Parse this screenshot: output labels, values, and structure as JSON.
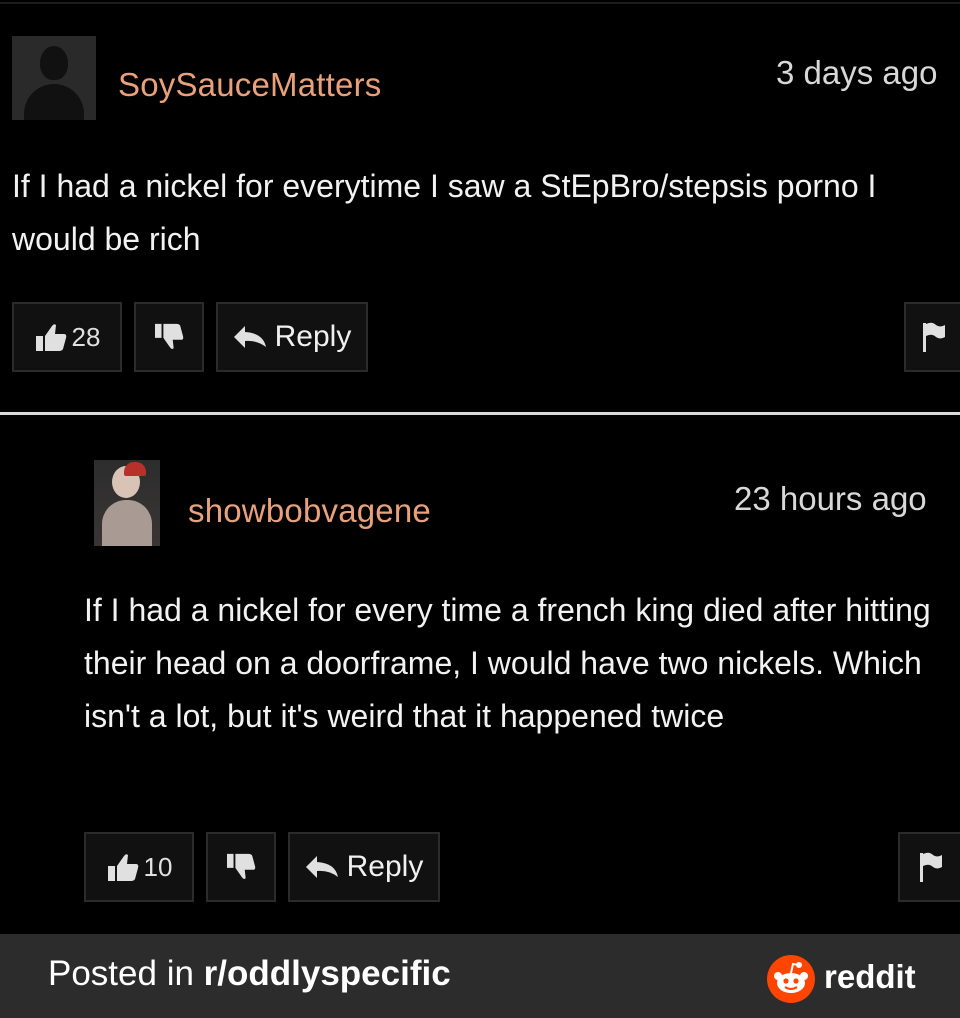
{
  "comments": [
    {
      "username": "SoySauceMatters",
      "timestamp": "3 days ago",
      "body": "If I had a nickel for everytime I saw a StEpBro/stepsis porno I would be rich",
      "upvotes": "28",
      "reply_label": "Reply"
    },
    {
      "username": "showbobvagene",
      "timestamp": "23 hours ago",
      "body": "If I had a nickel for every time a french king died after hitting their head on a doorframe, I would have two nickels. Which isn't a lot, but it's weird that it happened twice",
      "upvotes": "10",
      "reply_label": "Reply"
    }
  ],
  "footer": {
    "posted_prefix": "Posted in ",
    "subreddit": "r/oddlyspecific",
    "brand": "reddit",
    "brand_color": "#ff4500"
  },
  "colors": {
    "username": "#e8a17a",
    "background": "#000000",
    "footer_bg": "#2c2c2c"
  }
}
